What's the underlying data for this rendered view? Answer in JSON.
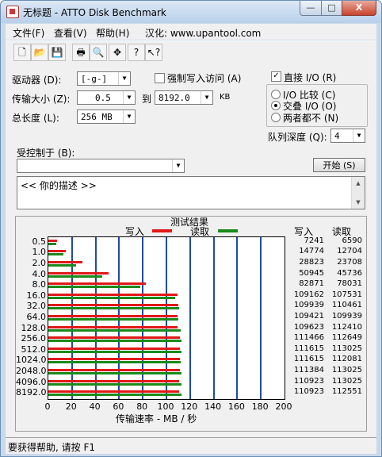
{
  "window": {
    "title": "无标题 - ATTO Disk Benchmark",
    "min": "—",
    "max": "□",
    "close": "X"
  },
  "menu": {
    "file": "文件(F)",
    "view": "查看(V)",
    "help": "帮助(H)",
    "localized": "汉化: www.upantool.com"
  },
  "toolbar": [
    "new-icon",
    "open-icon",
    "save-icon",
    "print-icon",
    "print-preview-icon",
    "move-icon",
    "help-icon",
    "context-help-icon"
  ],
  "form": {
    "drive_label": "驱动器 (D):",
    "drive_value": "[-g-]",
    "force_write_label": "强制写入访问 (A)",
    "direct_io_label": "直接 I/O (R)",
    "direct_io_checked": "✓",
    "transfer_label": "传输大小 (Z):",
    "transfer_from": "0.5",
    "to_label": "到",
    "transfer_to": "8192.0",
    "kb_label": "KB",
    "total_label": "总长度 (L):",
    "total_value": "256 MB",
    "io_compare": "I/O 比较 (C)",
    "overlap_io": "交叠 I/O (O)",
    "neither": "两者都不 (N)",
    "queue_label": "队列深度 (Q):",
    "queue_value": "4",
    "controlled_label": "受控制于 (B):",
    "controlled_value": "",
    "start_button": "开始 (S)",
    "description": "<<   你的描述    >>"
  },
  "results": {
    "title": "测试结果",
    "write_legend": "写入",
    "read_legend": "读取",
    "col_write": "写入",
    "col_read": "读取",
    "xaxis_title": "传输速率 - MB / 秒"
  },
  "chart_data": {
    "type": "bar",
    "title": "测试结果",
    "xlabel": "传输速率 - MB / 秒",
    "xlim": [
      0,
      200
    ],
    "xticks": [
      "0",
      "20",
      "40",
      "60",
      "80",
      "100",
      "120",
      "140",
      "160",
      "180",
      "200"
    ],
    "categories": [
      "0.5",
      "1.0",
      "2.0",
      "4.0",
      "8.0",
      "16.0",
      "32.0",
      "64.0",
      "128.0",
      "256.0",
      "512.0",
      "1024.0",
      "2048.0",
      "4096.0",
      "8192.0"
    ],
    "series": [
      {
        "name": "写入",
        "color": "#e11818",
        "values": [
          7241,
          14774,
          28823,
          50945,
          82871,
          109162,
          109939,
          109421,
          109623,
          111466,
          111615,
          111615,
          111384,
          110923,
          110923
        ]
      },
      {
        "name": "读取",
        "color": "#1a8a1a",
        "values": [
          6590,
          12704,
          23708,
          45736,
          78031,
          107531,
          110461,
          109939,
          112410,
          112649,
          113025,
          112081,
          113025,
          113025,
          112551
        ]
      }
    ]
  },
  "status": "要获得帮助, 请按 F1"
}
